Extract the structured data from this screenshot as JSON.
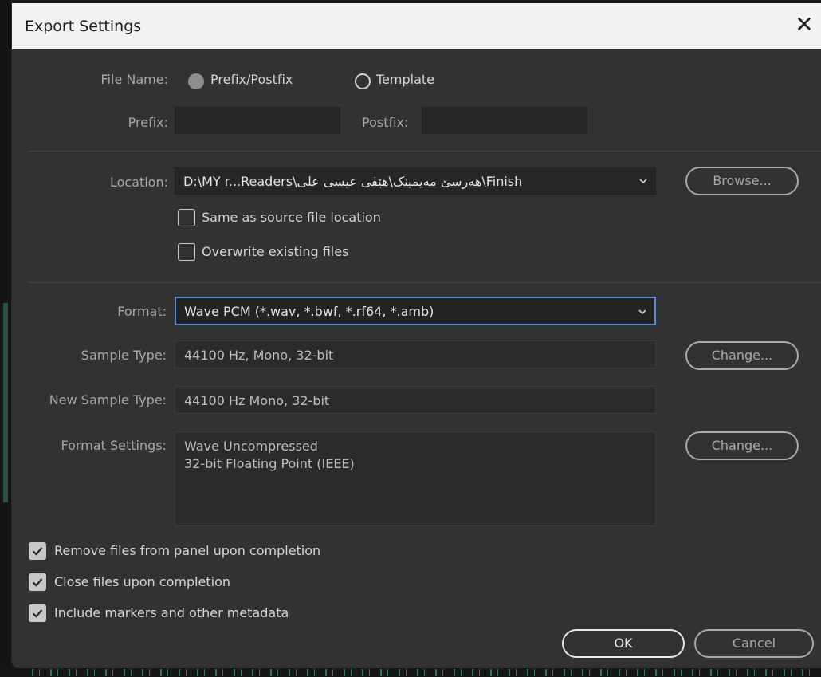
{
  "dialog": {
    "title": "Export Settings"
  },
  "file_name": {
    "label": "File Name:",
    "options": [
      "Prefix/Postfix",
      "Template"
    ],
    "selected": "Prefix/Postfix"
  },
  "prefix": {
    "label": "Prefix:",
    "value": ""
  },
  "postfix": {
    "label": "Postfix:",
    "value": ""
  },
  "location": {
    "label": "Location:",
    "value": "D:\\MY r...Readers\\هەرسێ مەیمینک\\هێڤی عیسی علی\\Finish",
    "browse_label": "Browse...",
    "same_as_source": {
      "label": "Same as source file location",
      "checked": false
    },
    "overwrite": {
      "label": "Overwrite existing files",
      "checked": false
    }
  },
  "format": {
    "label": "Format:",
    "value": "Wave PCM (*.wav, *.bwf, *.rf64, *.amb)"
  },
  "sample_type": {
    "label": "Sample Type:",
    "value": "44100 Hz, Mono, 32-bit",
    "change_label": "Change..."
  },
  "new_sample_type": {
    "label": "New Sample Type:",
    "value": "44100 Hz Mono, 32-bit"
  },
  "format_settings": {
    "label": "Format Settings:",
    "lines": [
      "Wave Uncompressed",
      "32-bit Floating Point (IEEE)"
    ],
    "change_label": "Change..."
  },
  "options": [
    {
      "label": "Remove files from panel upon completion",
      "checked": true
    },
    {
      "label": "Close files upon completion",
      "checked": true
    },
    {
      "label": "Include markers and other metadata",
      "checked": true
    }
  ],
  "buttons": {
    "ok": "OK",
    "cancel": "Cancel"
  },
  "colors": {
    "dialog_bg": "#323232",
    "titlebar_bg": "#f2f2f2",
    "focus_accent": "#5b8bd6"
  }
}
